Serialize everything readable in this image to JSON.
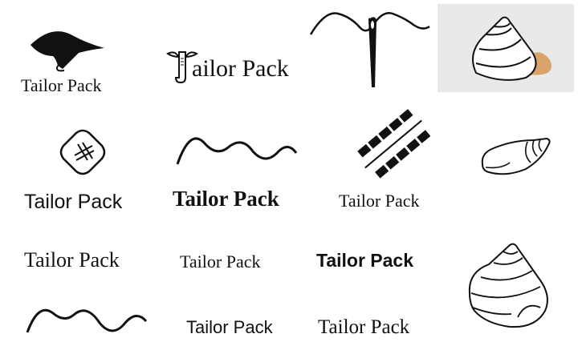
{
  "brand": "Tailor Pack",
  "logo_a": {
    "icon": "hat-leaf-icon",
    "wordmark": "Tailor Pack"
  },
  "logo_b": {
    "icon": "needle-t-glyph-icon",
    "wordmark_rest": "ailor Pack"
  },
  "logo_c": {
    "icon": "needle-and-thread-icon"
  },
  "logo_d": {
    "icon": "shell-photo-image"
  },
  "logo_e": {
    "icon": "diamond-hashtag-icon",
    "wordmark": "Tailor Pack"
  },
  "logo_f": {
    "icon": "thread-wave-icon",
    "wordmark": "Tailor Pack"
  },
  "logo_g": {
    "icon": "zipper-stitch-icon",
    "wordmark": "Tailor Pack"
  },
  "logo_h": {
    "icon": "snail-shell-icon"
  },
  "logo_i": {
    "wordmark": "Tailor Pack"
  },
  "logo_j": {
    "wordmark": "Tailor Pack"
  },
  "logo_k": {
    "wordmark": "Tailor Pack"
  },
  "logo_l": {
    "icon": "spiral-shell-icon"
  },
  "logo_m": {
    "icon": "thread-wave-icon"
  },
  "logo_n": {
    "wordmark": "Tailor Pack"
  },
  "logo_o": {
    "wordmark": "Tailor Pack"
  },
  "colors": {
    "ink": "#111111",
    "background": "#ffffff",
    "photo_bg": "#e9e9e9",
    "shell_tan": "#d9a46c"
  }
}
